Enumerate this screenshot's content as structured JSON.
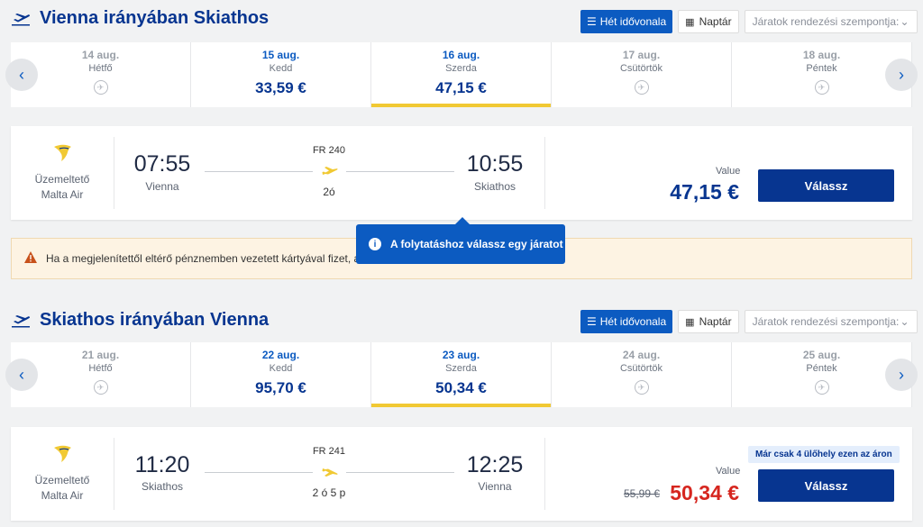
{
  "outbound": {
    "title": "Vienna irányában Skiathos",
    "week_label": "Hét idővonala",
    "calendar_label": "Naptár",
    "sort_placeholder": "Járatok rendezési szempontja:",
    "dates": [
      {
        "date": "14 aug.",
        "weekday": "Hétfő",
        "price": "",
        "state": "unavailable"
      },
      {
        "date": "15 aug.",
        "weekday": "Kedd",
        "price": "33,59 €",
        "state": "available"
      },
      {
        "date": "16 aug.",
        "weekday": "Szerda",
        "price": "47,15 €",
        "state": "selected"
      },
      {
        "date": "17 aug.",
        "weekday": "Csütörtök",
        "price": "",
        "state": "unavailable"
      },
      {
        "date": "18 aug.",
        "weekday": "Péntek",
        "price": "",
        "state": "unavailable"
      }
    ],
    "flight": {
      "operator_label": "Üzemeltető",
      "operator": "Malta Air",
      "dep_time": "07:55",
      "dep_city": "Vienna",
      "flight_no": "FR 240",
      "duration": "2ó",
      "arr_time": "10:55",
      "arr_city": "Skiathos",
      "value_label": "Value",
      "price": "47,15 €",
      "select_label": "Válassz"
    }
  },
  "tooltip": "A folytatáshoz válassz egy járatot",
  "warning": "Ha a megjelenítettől eltérő pénznemben vezetett kártyával fizet, a",
  "inbound": {
    "title": "Skiathos irányában Vienna",
    "week_label": "Hét idővonala",
    "calendar_label": "Naptár",
    "sort_placeholder": "Járatok rendezési szempontja:",
    "dates": [
      {
        "date": "21 aug.",
        "weekday": "Hétfő",
        "price": "",
        "state": "unavailable"
      },
      {
        "date": "22 aug.",
        "weekday": "Kedd",
        "price": "95,70 €",
        "state": "available"
      },
      {
        "date": "23 aug.",
        "weekday": "Szerda",
        "price": "50,34 €",
        "state": "selected"
      },
      {
        "date": "24 aug.",
        "weekday": "Csütörtök",
        "price": "",
        "state": "unavailable"
      },
      {
        "date": "25 aug.",
        "weekday": "Péntek",
        "price": "",
        "state": "unavailable"
      }
    ],
    "flight": {
      "operator_label": "Üzemeltető",
      "operator": "Malta Air",
      "dep_time": "11:20",
      "dep_city": "Skiathos",
      "flight_no": "FR 241",
      "duration": "2 ó 5 p",
      "arr_time": "12:25",
      "arr_city": "Vienna",
      "value_label": "Value",
      "badge": "Már csak 4 ülőhely ezen az áron",
      "old_price": "55,99 €",
      "price": "50,34 €",
      "select_label": "Válassz"
    }
  },
  "colors": {
    "brand": "#073590",
    "accent": "#0c5bc1",
    "highlight": "#f1c933",
    "sale": "#d6261f"
  }
}
